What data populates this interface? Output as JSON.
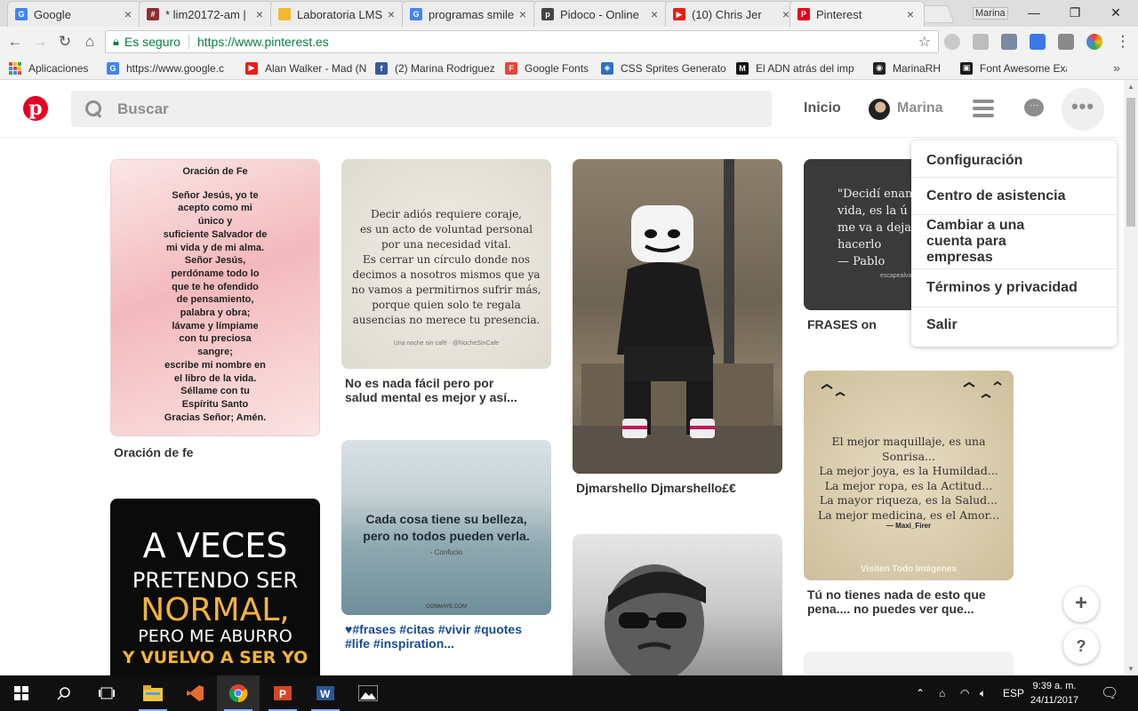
{
  "browser": {
    "tabs": [
      {
        "title": "Google",
        "color": "#4285f4",
        "glyph": "G"
      },
      {
        "title": "* lim20172-am |",
        "color": "#8d2f2f",
        "glyph": "#"
      },
      {
        "title": "Laboratoria LMS",
        "color": "#f2b82c",
        "glyph": "LMS"
      },
      {
        "title": "programas smile",
        "color": "#4285f4",
        "glyph": "G"
      },
      {
        "title": "Pidoco - Online",
        "color": "#444444",
        "glyph": "p"
      },
      {
        "title": "(10) Chris Jer",
        "color": "#e62117",
        "glyph": "▶"
      },
      {
        "title": "Pinterest",
        "color": "#e60023",
        "glyph": "P"
      }
    ],
    "profile_name": "Marina",
    "secure_label": "Es seguro",
    "url": "https://www.pinterest.es",
    "bookmarks": [
      {
        "label": "Aplicaciones",
        "type": "apps"
      },
      {
        "label": "https://www.google.c",
        "color": "#4285f4",
        "glyph": "G"
      },
      {
        "label": "Alan Walker - Mad (N",
        "color": "#e62117",
        "glyph": "▶"
      },
      {
        "label": "(2) Marina Rodriguez",
        "color": "#3b5998",
        "glyph": "f"
      },
      {
        "label": "Google Fonts",
        "color": "#e8453c",
        "glyph": "F"
      },
      {
        "label": "CSS Sprites Generato",
        "color": "#2f6fbf",
        "glyph": "◈"
      },
      {
        "label": "El ADN atrás del imp",
        "color": "#111111",
        "glyph": "M"
      },
      {
        "label": "MarinaRH",
        "color": "#222222",
        "glyph": "◉"
      },
      {
        "label": "Font Awesome Exam",
        "color": "#1a1a1a",
        "glyph": "▣"
      }
    ]
  },
  "header": {
    "search_placeholder": "Buscar",
    "home": "Inicio",
    "user": "Marina"
  },
  "menu": {
    "items": [
      "Configuración",
      "Centro de asistencia",
      "Cambiar a una cuenta para empresas",
      "Términos y privacidad",
      "Salir"
    ]
  },
  "pins": {
    "p1": {
      "lines": [
        "Oración de Fe",
        "",
        "Señor Jesús, yo te",
        "acepto como mi",
        "único y",
        "suficiente Salvador de",
        "mi vida y de mi alma.",
        "Señor Jesús,",
        "perdóname todo lo",
        "que te he ofendido",
        "de pensamiento,",
        "palabra y obra;",
        "lávame y límpiame",
        "con tu preciosa",
        "sangre;",
        "escribe mi nombre en",
        "el libro de la vida.",
        "Séllame con tu",
        "Espíritu Santo",
        "Gracias Señor; Amén."
      ],
      "caption": "Oración de fe"
    },
    "p2": {
      "lines": [
        "Decir adiós requiere coraje,",
        "es un acto de voluntad personal",
        "por una necesidad vital.",
        "Es cerrar un círculo donde nos",
        "decimos a nosotros mismos que ya",
        "no vamos a permitirnos sufrir más,",
        "porque quien solo te regala",
        "ausencias no merece tu presencia."
      ],
      "signature": "Una noche sin café · @NocheSinCafe",
      "caption": [
        "No es nada fácil pero por",
        "salud mental es mejor y así..."
      ]
    },
    "p3": {
      "caption": "Djmarshello Djmarshello£€"
    },
    "p4": {
      "lines": [
        "\"Decidí enam",
        "vida, es la ú",
        "me va a deja",
        "hacerlo",
        "— Pablo"
      ],
      "signature": "escapealva",
      "caption": "FRASES on"
    },
    "p5": {
      "lines": [
        "Cada cosa tiene su belleza,",
        "pero no todos pueden verla."
      ],
      "author": "- Confucio",
      "signature": "GONMAYE.COM",
      "caption": [
        "♥#frases #citas #vivir #quotes",
        "#life #inspiration..."
      ]
    },
    "p6": {
      "lines": [
        "El mejor maquillaje, es una Sonrisa...",
        "La mejor joya, es la Humildad...",
        "La mejor ropa, es la Actitud...",
        "La mayor riqueza, es la Salud...",
        "La mejor medicina, es el Amor..."
      ],
      "author": "— Maxi_Firer",
      "signature": "Visiten Todo Imágenes",
      "caption": [
        "Tú no tienes nada de esto que",
        "pena.... no puedes ver que..."
      ]
    },
    "p7": {
      "lines": [
        "A VECES",
        "PRETENDO SER",
        "NORMAL,",
        "PERO ME ABURRO",
        "Y VUELVO A SER YO"
      ]
    }
  },
  "fab": {
    "add": "+",
    "help": "?"
  },
  "taskbar": {
    "language": "ESP",
    "time": "9:39 a. m.",
    "date": "24/11/2017"
  }
}
